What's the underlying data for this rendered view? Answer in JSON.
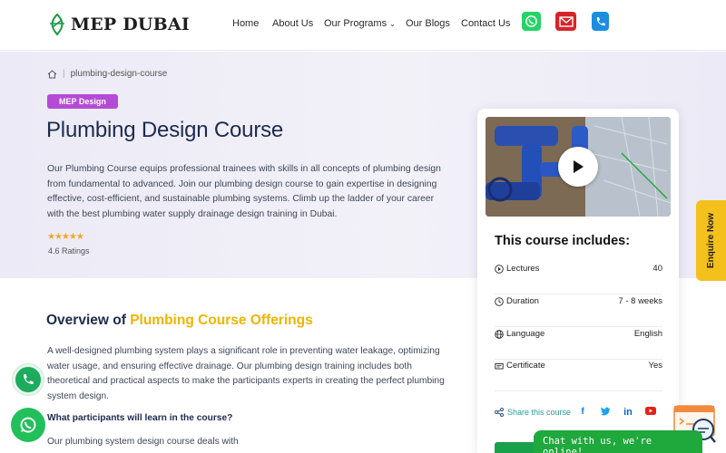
{
  "header": {
    "logo_text": "MEP DUBAI",
    "nav": [
      {
        "label": "Home"
      },
      {
        "label": "About Us"
      },
      {
        "label": "Our Programs"
      },
      {
        "label": "Our Blogs"
      },
      {
        "label": "Contact Us"
      }
    ],
    "icons": [
      "whatsapp-icon",
      "mail-icon",
      "phone-icon"
    ]
  },
  "breadcrumb": {
    "current": "plumbing-design-course"
  },
  "hero": {
    "tag": "MEP Design",
    "title": "Plumbing Design Course",
    "description": "Our Plumbing Course equips professional trainees with skills in all concepts of plumbing design from fundamental to advanced. Join our plumbing design course to gain expertise in designing effective, cost-efficient, and sustainable plumbing systems. Climb up the ladder of your career with the best plumbing water supply drainage design training in Dubai.",
    "stars": "★★★★★",
    "rating": 4.6,
    "ratings_label": "4.6 Ratings"
  },
  "overview": {
    "title_prefix": "Overview of",
    "title_highlight": "Plumbing Course Offerings",
    "paragraph": "A well-designed plumbing system plays a significant role in preventing water leakage, optimizing water usage, and ensuring effective drainage. Our plumbing design training includes both theoretical and practical aspects to make the participants experts in creating the perfect plumbing system design.",
    "question": "What participants will learn in the course?",
    "paragraph2": "Our plumbing system design course deals with"
  },
  "course_card": {
    "title": "This course includes:",
    "rows": [
      {
        "label": "Lectures",
        "value": "40",
        "icon": "play-circle-icon"
      },
      {
        "label": "Duration",
        "value": "7 - 8 weeks",
        "icon": "clock-icon"
      },
      {
        "label": "Language",
        "value": "English",
        "icon": "globe-icon"
      },
      {
        "label": "Certificate",
        "value": "Yes",
        "icon": "certificate-icon"
      }
    ],
    "share_label": "Share this course",
    "social": [
      "facebook-icon",
      "twitter-icon",
      "linkedin-icon",
      "youtube-icon"
    ]
  },
  "enquire": {
    "label": "Enquire Now"
  },
  "chat": {
    "label": "Chat with us, we're online!"
  },
  "colors": {
    "accent_purple": "#b44bd6",
    "highlight_yellow": "#f0b400",
    "navy": "#1d2b4f",
    "green": "#1fa83c"
  }
}
